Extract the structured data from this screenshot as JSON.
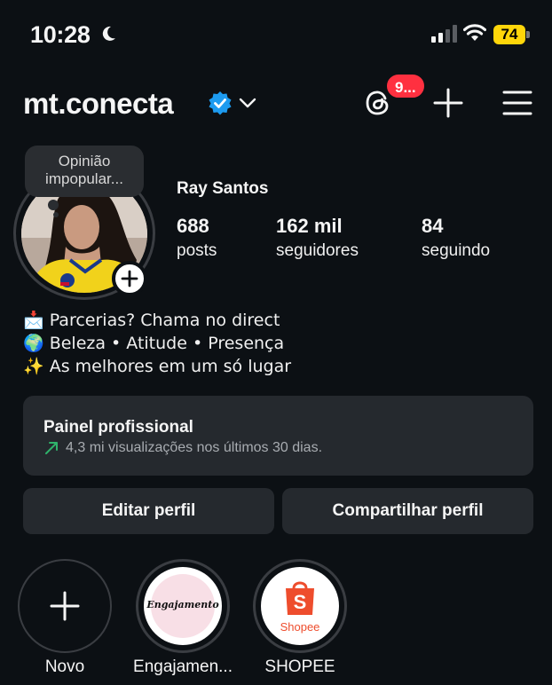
{
  "status_bar": {
    "time": "10:28",
    "battery": "74"
  },
  "header": {
    "username": "mt.conecta",
    "notification_count": "9..."
  },
  "profile": {
    "note": "Opinião impopular...",
    "name": "Ray Santos",
    "stats": [
      {
        "value": "688",
        "label": "posts"
      },
      {
        "value": "162 mil",
        "label": "seguidores"
      },
      {
        "value": "84",
        "label": "seguindo"
      }
    ],
    "bio": [
      "📩 Parcerias? Chama no direct",
      "🌍 Beleza • Atitude • Presença",
      "✨ As melhores em um só lugar"
    ]
  },
  "dashboard": {
    "title": "Painel profissional",
    "subtitle": "4,3 mi visualizações nos últimos 30 dias."
  },
  "buttons": {
    "edit": "Editar perfil",
    "share": "Compartilhar perfil"
  },
  "highlights": [
    {
      "label": "Novo"
    },
    {
      "label": "Engajamen...",
      "cover_text": "Engajamento"
    },
    {
      "label": "SHOPEE",
      "cover_text": "Shopee"
    }
  ],
  "colors": {
    "background": "#0c1014",
    "card": "#25292e",
    "badge": "#ff3040",
    "verified": "#1d9bf0",
    "battery": "#ffd60a",
    "shopee": "#ee4d2d"
  },
  "icons": {
    "moon": "moon-icon",
    "signal": "cellular-signal-icon",
    "wifi": "wifi-icon",
    "verified": "verified-badge-icon",
    "threads": "threads-icon",
    "create": "plus-icon",
    "menu": "hamburger-menu-icon",
    "trend": "trend-up-arrow-icon"
  }
}
